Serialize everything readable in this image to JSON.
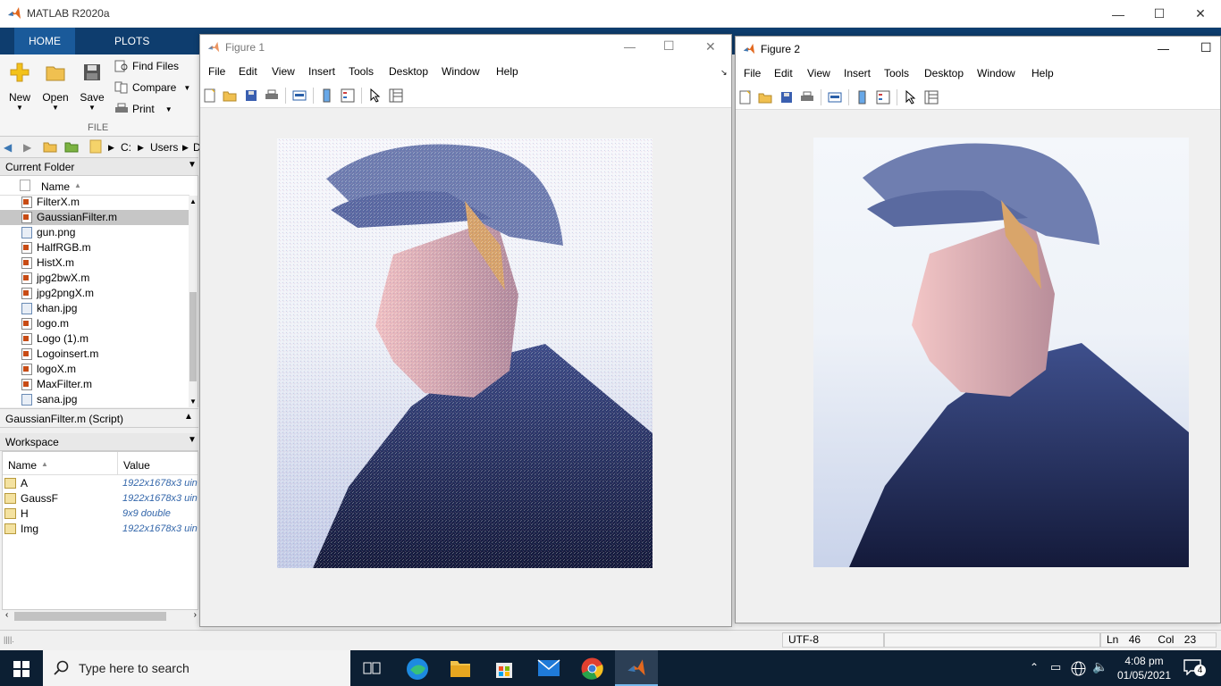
{
  "app": {
    "title": "MATLAB R2020a"
  },
  "ribbon": {
    "tabs": [
      "HOME",
      "PLOTS"
    ],
    "new_label": "New",
    "open_label": "Open",
    "save_label": "Save",
    "find_files_label": "Find Files",
    "compare_label": "Compare",
    "print_label": "Print",
    "group_label": "FILE"
  },
  "address": {
    "crumbs": [
      "C:",
      "Users",
      "D"
    ]
  },
  "current_folder": {
    "title": "Current Folder",
    "column_name": "Name",
    "files": [
      {
        "name": "FilterX.m",
        "type": "m"
      },
      {
        "name": "GaussianFilter.m",
        "type": "m",
        "selected": true
      },
      {
        "name": "gun.png",
        "type": "img"
      },
      {
        "name": "HalfRGB.m",
        "type": "m"
      },
      {
        "name": "HistX.m",
        "type": "m"
      },
      {
        "name": "jpg2bwX.m",
        "type": "m"
      },
      {
        "name": "jpg2pngX.m",
        "type": "m"
      },
      {
        "name": "khan.jpg",
        "type": "img"
      },
      {
        "name": "logo.m",
        "type": "m"
      },
      {
        "name": "Logo (1).m",
        "type": "m"
      },
      {
        "name": "Logoinsert.m",
        "type": "m"
      },
      {
        "name": "logoX.m",
        "type": "m"
      },
      {
        "name": "MaxFilter.m",
        "type": "m"
      },
      {
        "name": "sana.jpg",
        "type": "img"
      }
    ],
    "details": "GaussianFilter.m  (Script)"
  },
  "workspace": {
    "title": "Workspace",
    "col_name": "Name",
    "col_value": "Value",
    "vars": [
      {
        "name": "A",
        "value": "1922x1678x3 uint"
      },
      {
        "name": "GaussF",
        "value": "1922x1678x3 uint"
      },
      {
        "name": "H",
        "value": "9x9 double"
      },
      {
        "name": "Img",
        "value": "1922x1678x3 uint"
      }
    ]
  },
  "figure1": {
    "title": "Figure 1"
  },
  "figure2": {
    "title": "Figure 2"
  },
  "figure_menu": [
    "File",
    "Edit",
    "View",
    "Insert",
    "Tools",
    "Desktop",
    "Window",
    "Help"
  ],
  "status": {
    "encoding": "UTF-8",
    "ln_label": "Ln",
    "ln": "46",
    "col_label": "Col",
    "col": "23"
  },
  "taskbar": {
    "search_placeholder": "Type here to search",
    "time": "4:08 pm",
    "date": "01/05/2021",
    "notifications": "4"
  }
}
